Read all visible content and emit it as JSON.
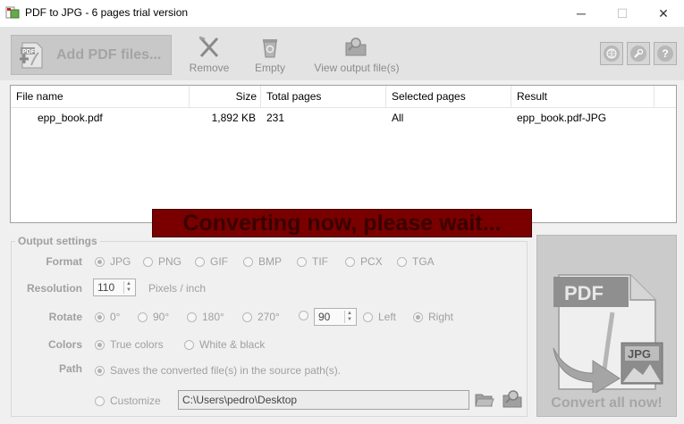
{
  "window": {
    "title": "PDF to JPG - 6 pages trial version",
    "minimize_glyph": "─",
    "maximize_glyph": "☐",
    "close_glyph": "✕"
  },
  "toolbar": {
    "add_pdf_label": "Add PDF files...",
    "add_pdf_icon_text": "PDF",
    "remove_label": "Remove",
    "empty_label": "Empty",
    "view_output_label": "View output file(s)",
    "help_glyph": "?"
  },
  "file_list": {
    "columns": [
      "File name",
      "Size",
      "Total pages",
      "Selected pages",
      "Result"
    ],
    "rows": [
      {
        "name": "epp_book.pdf",
        "size": "1,892 KB",
        "total_pages": "231",
        "selected_pages": "All",
        "result": "epp_book.pdf-JPG"
      }
    ]
  },
  "status": {
    "converting_text": "Converting now, please wait..."
  },
  "settings": {
    "legend": "Output settings",
    "format": {
      "label": "Format",
      "options": [
        "JPG",
        "PNG",
        "GIF",
        "BMP",
        "TIF",
        "PCX",
        "TGA"
      ],
      "selected": "JPG"
    },
    "resolution": {
      "label": "Resolution",
      "value": "110",
      "unit": "Pixels / inch"
    },
    "rotate": {
      "label": "Rotate",
      "options": [
        "0°",
        "90°",
        "180°",
        "270°"
      ],
      "selected": "0°",
      "custom_value": "90",
      "direction_options": [
        "Left",
        "Right"
      ],
      "direction_selected": "Right"
    },
    "colors": {
      "label": "Colors",
      "options": [
        "True colors",
        "White & black"
      ],
      "selected": "True colors"
    },
    "path": {
      "label": "Path",
      "source_option": "Saves the converted file(s) in the source path(s).",
      "customize_option": "Customize",
      "value": "C:\\Users\\pedro\\Desktop"
    }
  },
  "convert": {
    "label": "Convert all now!",
    "pdf_badge": "PDF",
    "jpg_badge": "JPG"
  },
  "colors": {
    "banner_bg": "#7a0000",
    "banner_text": "#3a0000",
    "disabled_text": "#a0a0a0"
  }
}
